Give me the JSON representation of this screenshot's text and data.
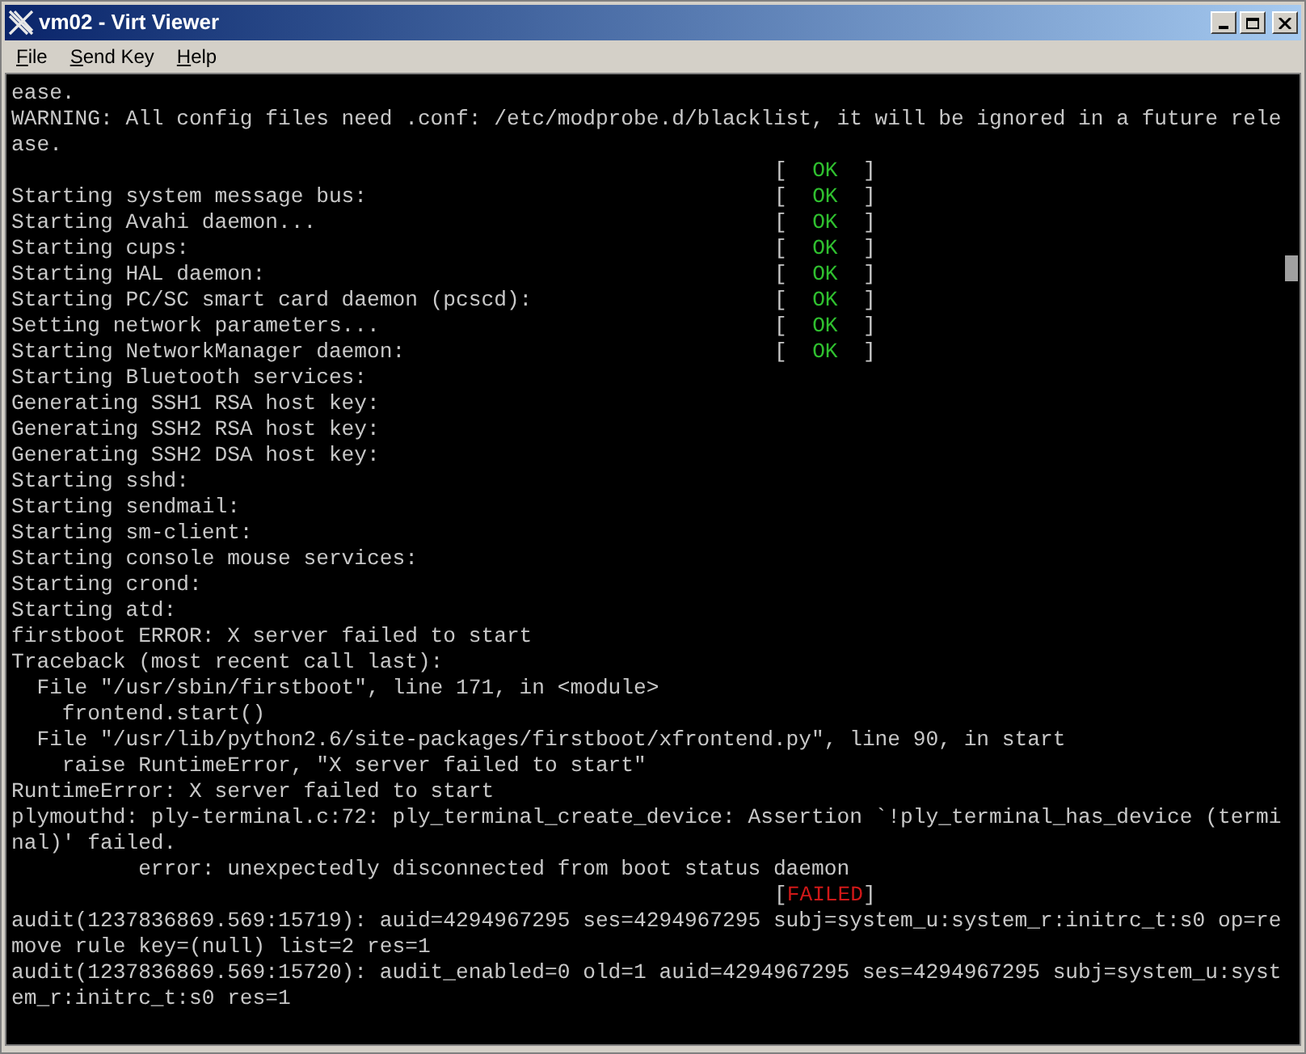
{
  "window": {
    "title": "vm02 - Virt Viewer"
  },
  "menu": [
    {
      "label": "File"
    },
    {
      "label": "Send Key"
    },
    {
      "label": "Help"
    }
  ],
  "console": {
    "lines": [
      {
        "text": "ease."
      },
      {
        "text": "WARNING: All config files need .conf: /etc/modprobe.d/blacklist, it will be ignored in a future rele"
      },
      {
        "text": "ase."
      },
      {
        "status": {
          "text": "[  OK  ]",
          "kind": "ok"
        }
      },
      {
        "text": "Starting system message bus:",
        "status": {
          "text": "[  OK  ]",
          "kind": "ok"
        }
      },
      {
        "text": "Starting Avahi daemon...",
        "status": {
          "text": "[  OK  ]",
          "kind": "ok"
        }
      },
      {
        "text": "Starting cups:",
        "status": {
          "text": "[  OK  ]",
          "kind": "ok"
        }
      },
      {
        "text": "Starting HAL daemon:",
        "status": {
          "text": "[  OK  ]",
          "kind": "ok"
        }
      },
      {
        "text": "Starting PC/SC smart card daemon (pcscd):",
        "status": {
          "text": "[  OK  ]",
          "kind": "ok"
        }
      },
      {
        "text": "Setting network parameters...",
        "status": {
          "text": "[  OK  ]",
          "kind": "ok"
        }
      },
      {
        "text": "Starting NetworkManager daemon:",
        "status": {
          "text": "[  OK  ]",
          "kind": "ok"
        }
      },
      {
        "text": "Starting Bluetooth services:"
      },
      {
        "text": "Generating SSH1 RSA host key:"
      },
      {
        "text": "Generating SSH2 RSA host key:"
      },
      {
        "text": "Generating SSH2 DSA host key:"
      },
      {
        "text": "Starting sshd:"
      },
      {
        "text": "Starting sendmail:"
      },
      {
        "text": "Starting sm-client:"
      },
      {
        "text": "Starting console mouse services:"
      },
      {
        "text": "Starting crond:"
      },
      {
        "text": "Starting atd:"
      },
      {
        "text": "firstboot ERROR: X server failed to start"
      },
      {
        "text": "Traceback (most recent call last):"
      },
      {
        "text": "  File \"/usr/sbin/firstboot\", line 171, in <module>"
      },
      {
        "text": "    frontend.start()"
      },
      {
        "text": "  File \"/usr/lib/python2.6/site-packages/firstboot/xfrontend.py\", line 90, in start"
      },
      {
        "text": "    raise RuntimeError, \"X server failed to start\""
      },
      {
        "text": "RuntimeError: X server failed to start"
      },
      {
        "text": "plymouthd: ply-terminal.c:72: ply_terminal_create_device: Assertion `!ply_terminal_has_device (termi"
      },
      {
        "text": "nal)' failed."
      },
      {
        "text": "          error: unexpectedly disconnected from boot status daemon"
      },
      {
        "status": {
          "text": "[FAILED]",
          "kind": "failed"
        }
      },
      {
        "text": "audit(1237836869.569:15719): auid=4294967295 ses=4294967295 subj=system_u:system_r:initrc_t:s0 op=re"
      },
      {
        "text": "move rule key=(null) list=2 res=1"
      },
      {
        "text": "audit(1237836869.569:15720): audit_enabled=0 old=1 auid=4294967295 ses=4294967295 subj=system_u:syst"
      },
      {
        "text": "em_r:initrc_t:s0 res=1"
      }
    ]
  }
}
